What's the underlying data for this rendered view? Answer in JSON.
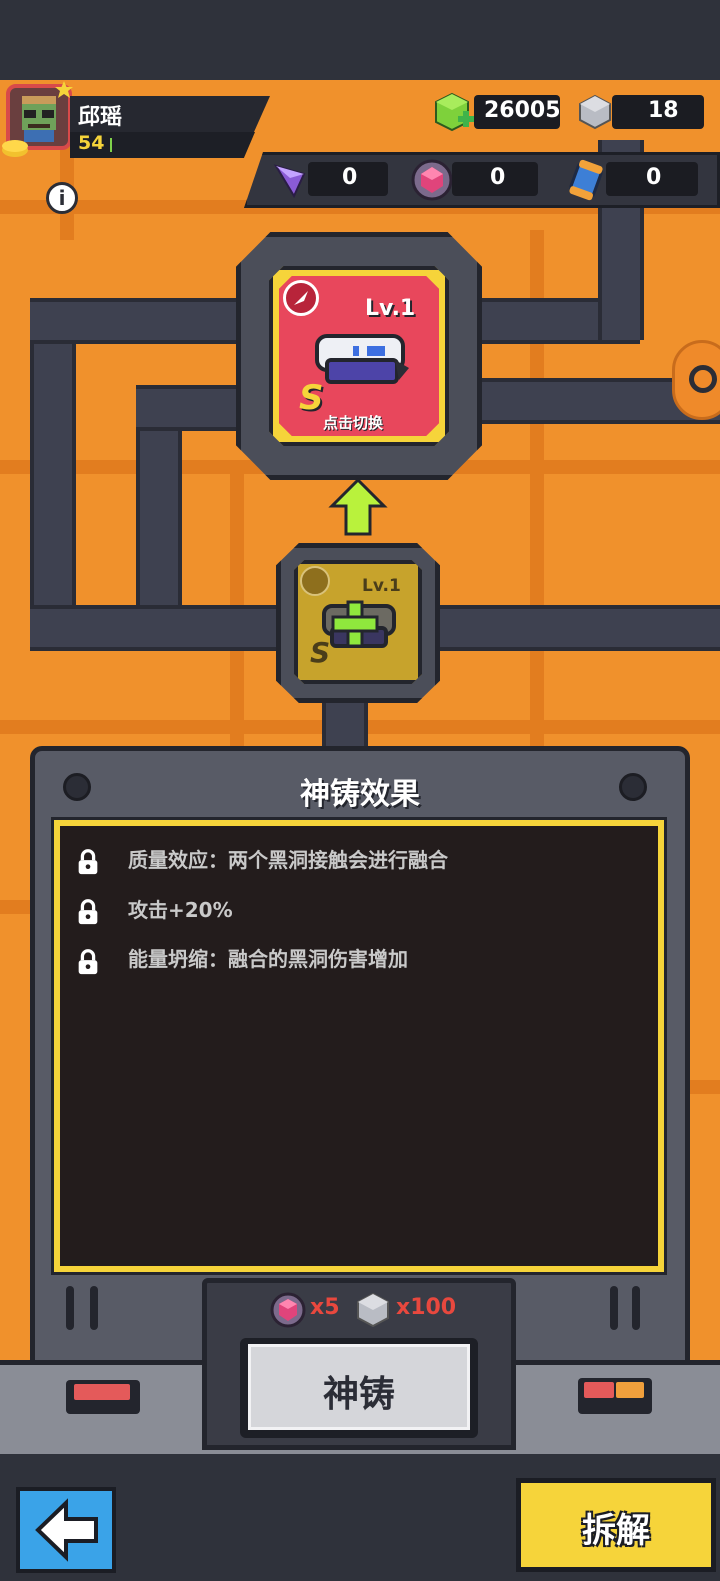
{
  "player": {
    "name": "邱瑶",
    "level": "54"
  },
  "currencies": {
    "green_gem": "26005",
    "silver_cube": "18"
  },
  "materials": [
    {
      "icon": "purple-crystal-icon",
      "count": "0"
    },
    {
      "icon": "pink-orb-icon",
      "count": "0"
    },
    {
      "icon": "capsule-icon",
      "count": "0"
    }
  ],
  "weapon": {
    "level": "Lv.1",
    "grade": "S",
    "switch_label": "点击切换"
  },
  "fusion_slot": {
    "level": "Lv.1",
    "grade": "S"
  },
  "panel": {
    "title": "神铸效果",
    "effects": [
      "质量效应：两个黑洞接触会进行融合",
      "攻击+20%",
      "能量坍缩：融合的黑洞伤害增加"
    ]
  },
  "cost": {
    "orb_count": "x5",
    "cube_count": "x100"
  },
  "buttons": {
    "forge": "神铸",
    "dismantle": "拆解"
  },
  "colors": {
    "background": "#f0912c",
    "pipe": "#3e4150",
    "accent_yellow": "#f6d43a",
    "weapon_card": "#e8475c",
    "cost_red": "#e8483e",
    "back_button": "#3aa3e8"
  }
}
